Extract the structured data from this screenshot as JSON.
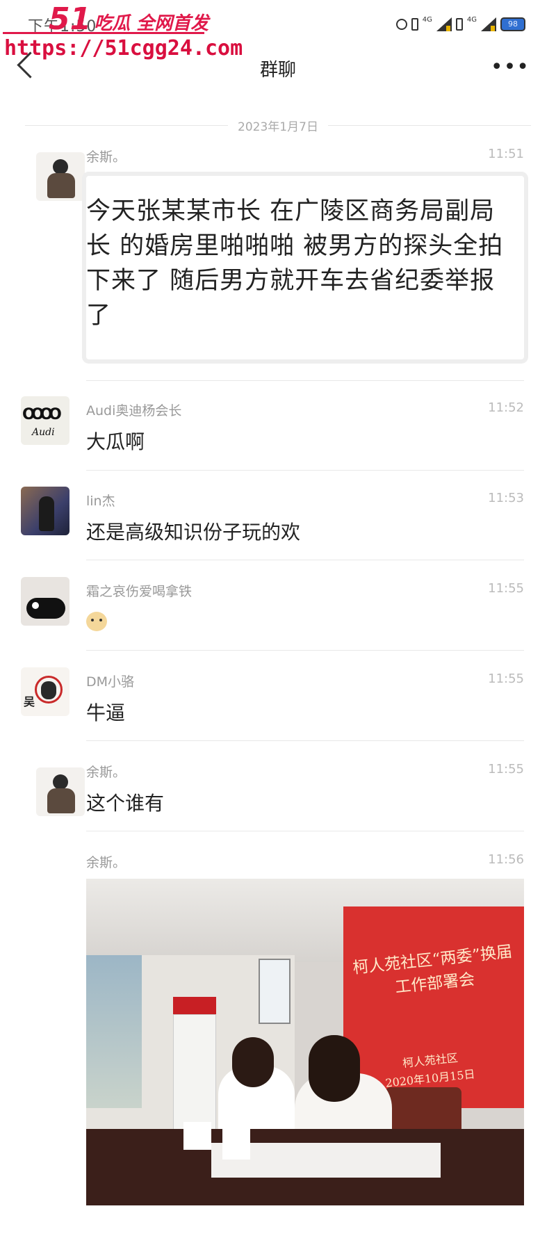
{
  "status_bar": {
    "time": "下午1:50"
  },
  "watermark": {
    "number": "51",
    "tagline": "吃瓜 全网首发",
    "url": "https://51cgg24.com"
  },
  "nav": {
    "title": "群聊"
  },
  "date_divider": "2023年1月7日",
  "messages": [
    {
      "sender": "余斯。",
      "time": "11:51",
      "text": "今天张某某市长 在广陵区商务局副局长 的婚房里啪啪啪 被男方的探头全拍下来了 随后男方就开车去省纪委举报了",
      "avatar": "person-avatar"
    },
    {
      "sender": "Audi奥迪杨会长",
      "time": "11:52",
      "text": "大瓜啊",
      "avatar": "audi-avatar"
    },
    {
      "sender": "lin杰",
      "time": "11:53",
      "text": "还是高级知识份子玩的欢",
      "avatar": "lin-avatar"
    },
    {
      "sender": "霜之哀伤爱喝拿铁",
      "time": "11:55",
      "text": "",
      "avatar": "bear-avatar",
      "emoji": "doge-emoji"
    },
    {
      "sender": "DM小骆",
      "time": "11:55",
      "text": "牛逼",
      "avatar": "dm-avatar"
    },
    {
      "sender": "余斯。",
      "time": "11:55",
      "text": "这个谁有",
      "avatar": "person-avatar"
    },
    {
      "sender": "余斯。",
      "time": "11:56",
      "text": "",
      "image": "meeting-photo"
    }
  ],
  "avatar_labels": {
    "audi": "Audi",
    "dm": "吴"
  },
  "photo": {
    "banner_title": "柯人苑社区“两委”换届工作部署会",
    "banner_org": "柯人苑社区",
    "banner_date": "2020年10月15日"
  }
}
